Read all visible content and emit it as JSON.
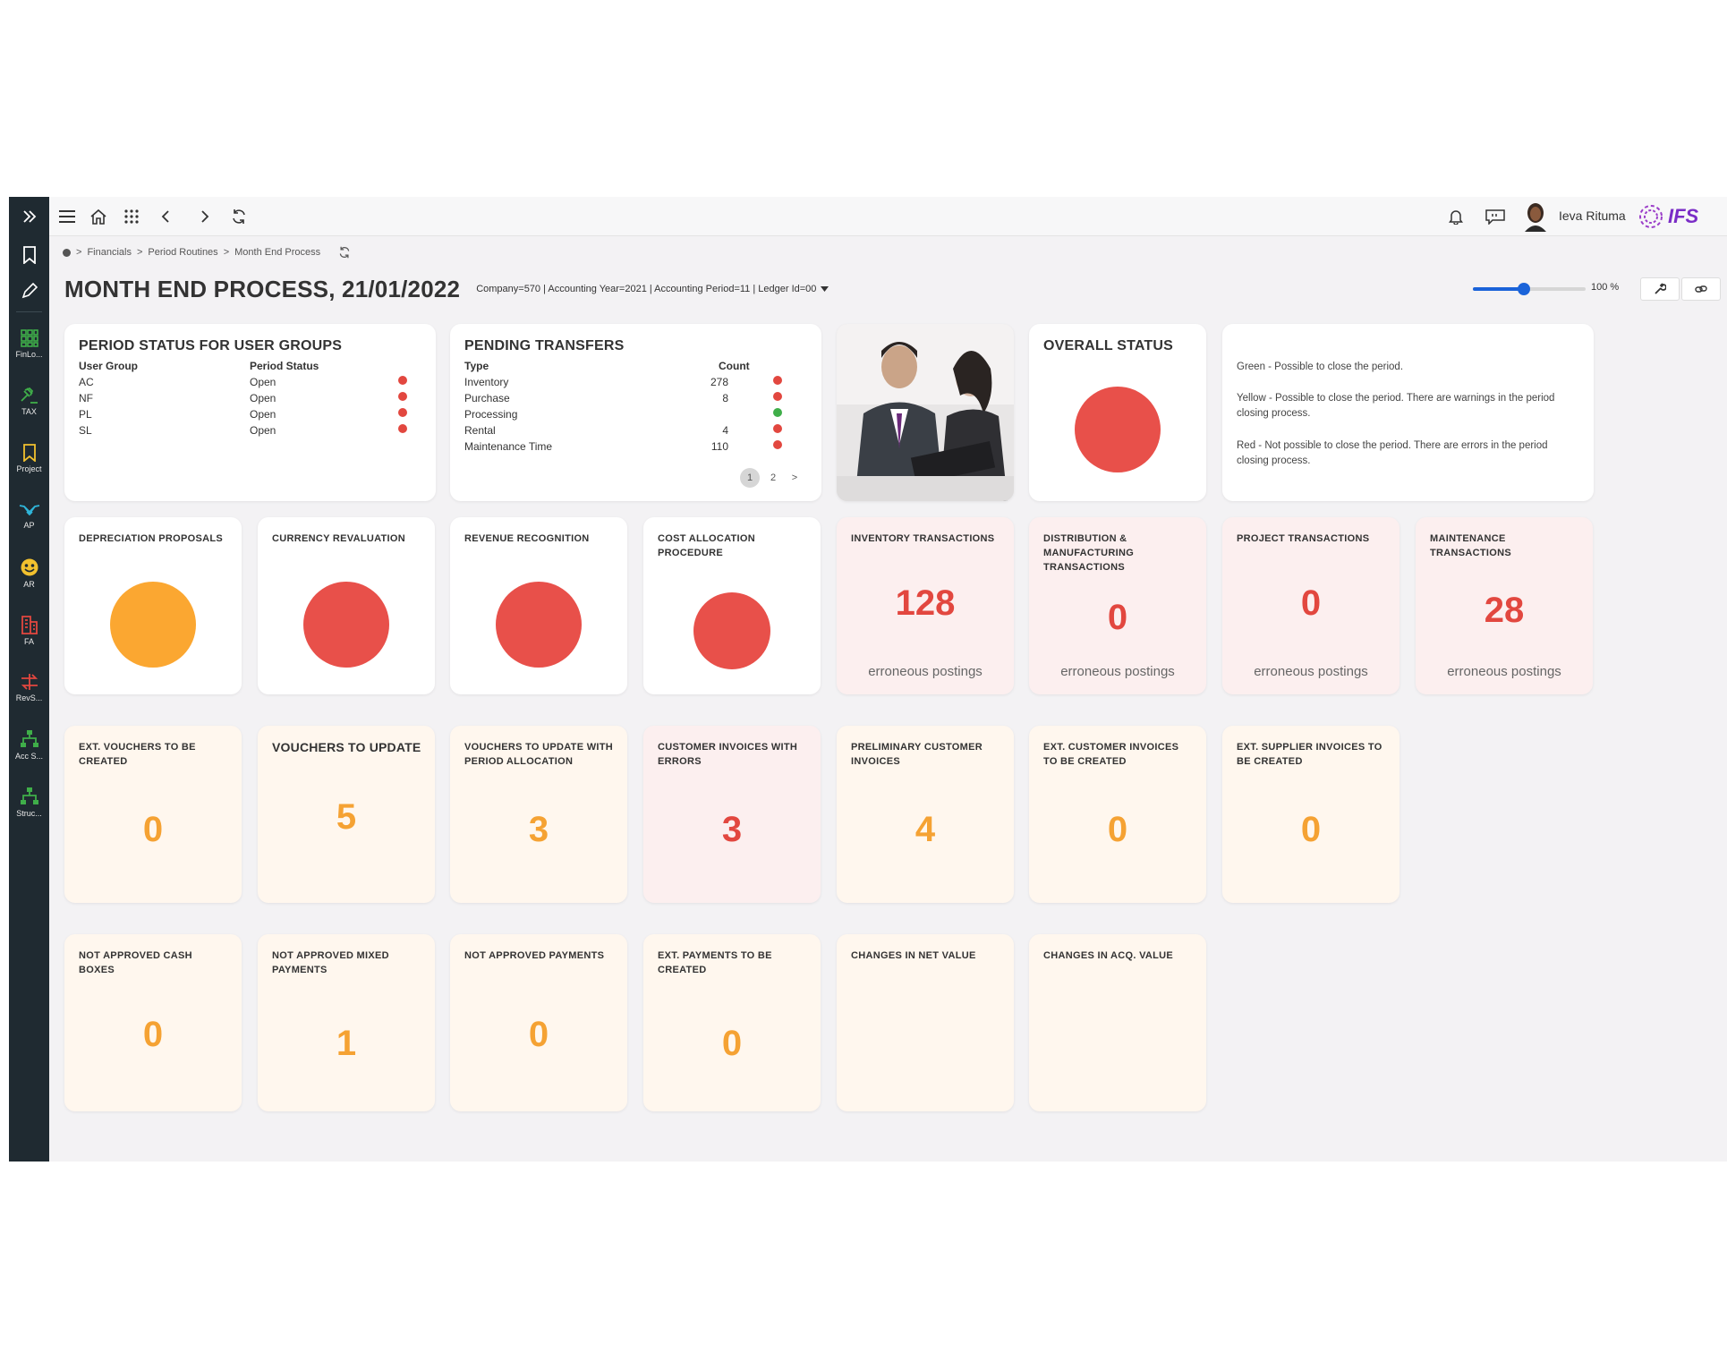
{
  "rail": {
    "items": [
      {
        "label": "FinLo...",
        "icon": "grid-icon",
        "color": "#3fae49"
      },
      {
        "label": "TAX",
        "icon": "gavel-icon",
        "color": "#3fae49"
      },
      {
        "label": "Project",
        "icon": "bookmark-icon",
        "color": "#f2c12e"
      },
      {
        "label": "AP",
        "icon": "handshake-icon",
        "color": "#2fb5d9"
      },
      {
        "label": "AR",
        "icon": "smiley-icon",
        "color": "#f2c12e"
      },
      {
        "label": "FA",
        "icon": "building-icon",
        "color": "#e2473f"
      },
      {
        "label": "RevS...",
        "icon": "arrows-icon",
        "color": "#e2473f"
      },
      {
        "label": "Acc S...",
        "icon": "hierarchy-icon",
        "color": "#3fae49"
      },
      {
        "label": "Struc...",
        "icon": "hierarchy-icon",
        "color": "#3fae49"
      }
    ]
  },
  "topbar": {
    "user_name": "Ieva Rituma",
    "logo_text": "IFS"
  },
  "breadcrumb": {
    "items": [
      "Financials",
      "Period Routines",
      "Month End Process"
    ]
  },
  "header": {
    "title": "MONTH END PROCESS, 21/01/2022",
    "context": "Company=570 | Accounting Year=2021 | Accounting Period=11 | Ledger Id=00",
    "zoom": "100 %",
    "zoom_value": 0.45
  },
  "period_status": {
    "title": "PERIOD STATUS FOR USER GROUPS",
    "col_group": "User Group",
    "col_status": "Period Status",
    "rows": [
      {
        "group": "AC",
        "status": "Open",
        "color": "#e2473f"
      },
      {
        "group": "NF",
        "status": "Open",
        "color": "#e2473f"
      },
      {
        "group": "PL",
        "status": "Open",
        "color": "#e2473f"
      },
      {
        "group": "SL",
        "status": "Open",
        "color": "#e2473f"
      }
    ]
  },
  "pending": {
    "title": "PENDING TRANSFERS",
    "col_type": "Type",
    "col_count": "Count",
    "rows": [
      {
        "type": "Inventory",
        "count": "278",
        "color": "#e2473f"
      },
      {
        "type": "Purchase",
        "count": "8",
        "color": "#e2473f"
      },
      {
        "type": "Processing",
        "count": "",
        "color": "#3fae49"
      },
      {
        "type": "Rental",
        "count": "4",
        "color": "#e2473f"
      },
      {
        "type": "Maintenance Time",
        "count": "110",
        "color": "#e2473f"
      }
    ],
    "pages": [
      "1",
      "2",
      ">"
    ]
  },
  "overall": {
    "title": "OVERALL STATUS",
    "color": "#e8504a"
  },
  "legend": {
    "green": "Green - Possible to close the period.",
    "yellow": "Yellow - Possible to close the period. There are warnings in the period closing process.",
    "red": "Red - Not possible to close the period. There are errors in the period closing process."
  },
  "status_cards": [
    {
      "title": "DEPRECIATION PROPOSALS",
      "color": "#fba731"
    },
    {
      "title": "CURRENCY REVALUATION",
      "color": "#e8504a"
    },
    {
      "title": "REVENUE RECOGNITION",
      "color": "#e8504a"
    },
    {
      "title": "COST ALLOCATION PROCEDURE",
      "color": "#e8504a"
    }
  ],
  "transactions": [
    {
      "title": "INVENTORY TRANSACTIONS",
      "value": "128",
      "caption": "erroneous postings"
    },
    {
      "title": "DISTRIBUTION & MANUFACTURING TRANSACTIONS",
      "value": "0",
      "caption": "erroneous postings"
    },
    {
      "title": "PROJECT TRANSACTIONS",
      "value": "0",
      "caption": "erroneous postings"
    },
    {
      "title": "MAINTENANCE TRANSACTIONS",
      "value": "28",
      "caption": "erroneous postings"
    }
  ],
  "row3": [
    {
      "title": "EXT. VOUCHERS TO BE CREATED",
      "value": "0"
    },
    {
      "title": "VOUCHERS TO UPDATE",
      "value": "5"
    },
    {
      "title": "VOUCHERS TO UPDATE WITH PERIOD ALLOCATION",
      "value": "3"
    },
    {
      "title": "CUSTOMER INVOICES WITH ERRORS",
      "value": "3"
    },
    {
      "title": "PRELIMINARY CUSTOMER INVOICES",
      "value": "4"
    },
    {
      "title": "EXT. CUSTOMER INVOICES TO BE CREATED",
      "value": "0"
    },
    {
      "title": "EXT. SUPPLIER INVOICES TO BE CREATED",
      "value": "0"
    }
  ],
  "row4": [
    {
      "title": "NOT APPROVED CASH BOXES",
      "value": "0"
    },
    {
      "title": "NOT APPROVED MIXED PAYMENTS",
      "value": "1"
    },
    {
      "title": "NOT APPROVED PAYMENTS",
      "value": "0"
    },
    {
      "title": "EXT. PAYMENTS TO BE CREATED",
      "value": "0"
    },
    {
      "title": "CHANGES IN NET VALUE",
      "value": ""
    },
    {
      "title": "CHANGES IN ACQ. VALUE",
      "value": ""
    }
  ]
}
